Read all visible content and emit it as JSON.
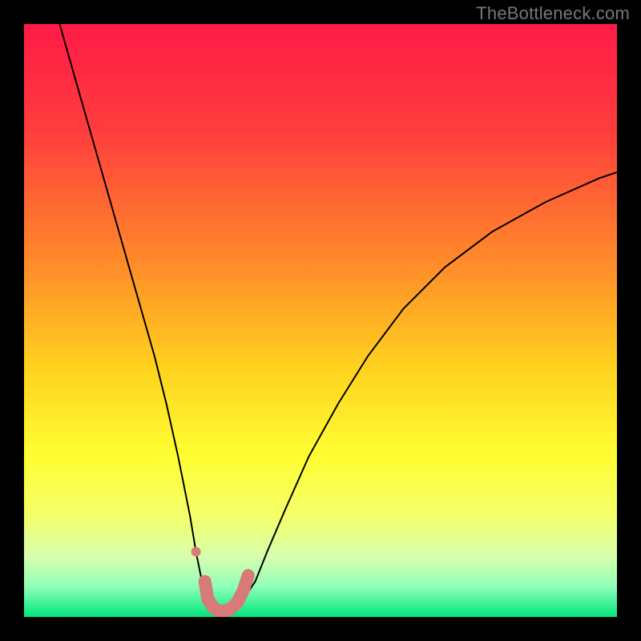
{
  "watermark": "TheBottleneck.com",
  "chart_data": {
    "type": "line",
    "title": "",
    "xlabel": "",
    "ylabel": "",
    "xlim": [
      0,
      100
    ],
    "ylim": [
      0,
      100
    ],
    "background_gradient": {
      "stops": [
        {
          "offset": 0.0,
          "color": "#ff1a47"
        },
        {
          "offset": 0.18,
          "color": "#ff3d3d"
        },
        {
          "offset": 0.4,
          "color": "#ff8a2a"
        },
        {
          "offset": 0.58,
          "color": "#ffd21f"
        },
        {
          "offset": 0.73,
          "color": "#ffff33"
        },
        {
          "offset": 0.83,
          "color": "#f4ff6a"
        },
        {
          "offset": 0.9,
          "color": "#d6ffae"
        },
        {
          "offset": 0.95,
          "color": "#8dffb8"
        },
        {
          "offset": 1.0,
          "color": "#00e67a"
        }
      ]
    },
    "series": [
      {
        "name": "bottleneck-curve",
        "color": "#000000",
        "stroke_width": 2,
        "x": [
          6,
          8,
          10,
          12,
          14,
          16,
          18,
          20,
          22,
          24,
          26,
          27,
          28,
          29,
          30,
          31,
          32,
          33,
          34,
          35,
          37,
          39,
          41,
          44,
          48,
          53,
          58,
          64,
          71,
          79,
          88,
          97,
          100
        ],
        "y": [
          100,
          93,
          86,
          79,
          72,
          65,
          58,
          51,
          44,
          36,
          27,
          22,
          17,
          11,
          6,
          3,
          1.5,
          1,
          1,
          1.5,
          3,
          6,
          11,
          18,
          27,
          36,
          44,
          52,
          59,
          65,
          70,
          74,
          75
        ]
      },
      {
        "name": "highlight-segment",
        "color": "#d87a78",
        "stroke_width": 16,
        "linecap": "round",
        "x": [
          30.5,
          31,
          32,
          33,
          34,
          35,
          36,
          37,
          37.8
        ],
        "y": [
          6,
          3,
          1.5,
          1,
          1,
          1.5,
          2.5,
          4.5,
          7
        ]
      }
    ],
    "markers": [
      {
        "name": "highlight-dot",
        "x": 29,
        "y": 11,
        "r": 6,
        "color": "#d87a78"
      }
    ]
  }
}
